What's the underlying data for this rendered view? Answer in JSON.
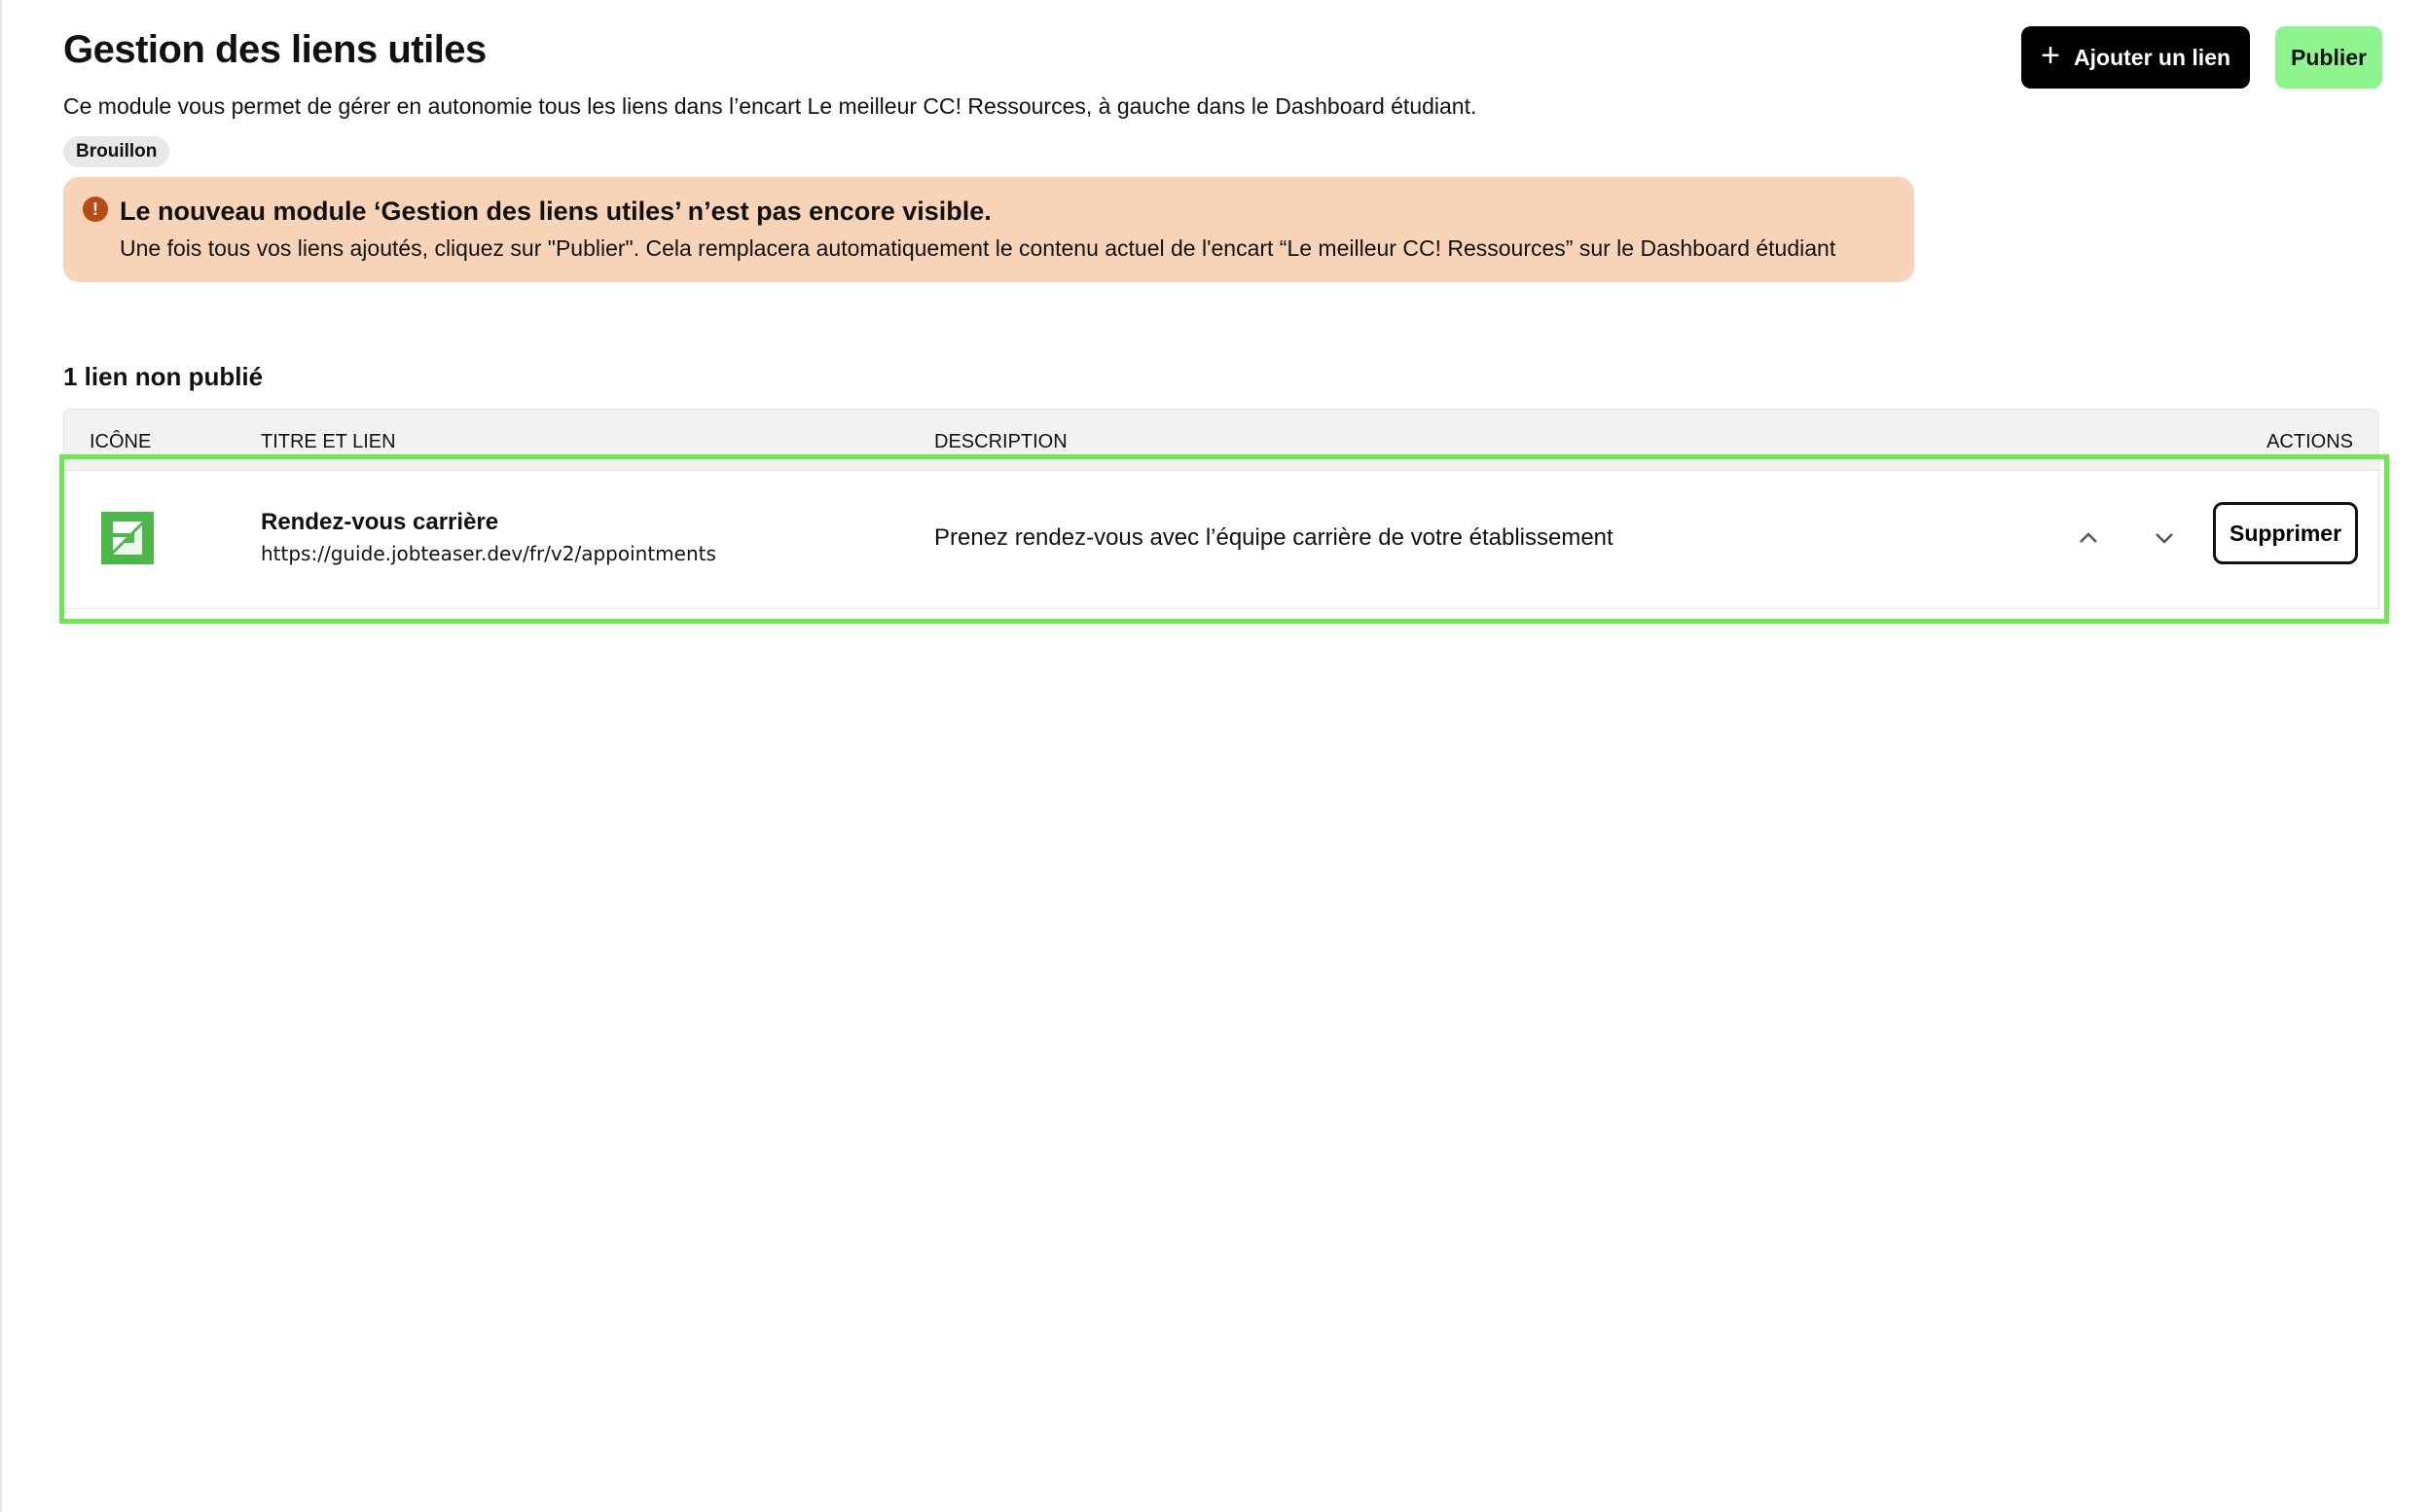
{
  "header": {
    "title": "Gestion des liens utiles",
    "description": "Ce module vous permet de gérer en autonomie tous les liens dans l’encart Le meilleur CC! Ressources, à gauche dans le Dashboard étudiant.",
    "status_badge": "Brouillon",
    "add_button": "Ajouter un lien",
    "add_icon": "plus-icon",
    "publish_button": "Publier"
  },
  "alert": {
    "icon": "exclamation-icon",
    "title": "Le nouveau module ‘Gestion des liens utiles’ n’est pas encore visible.",
    "text": "Une fois tous vos liens ajoutés, cliquez sur \"Publier\". Cela remplacera automatiquement le contenu actuel de l'encart “Le meilleur CC! Ressources” sur le Dashboard étudiant",
    "background": "#f7d4b8",
    "icon_color": "#b84a14"
  },
  "section": {
    "title": "1 lien non publié"
  },
  "table": {
    "columns": {
      "icon": "ICÔNE",
      "title": "TITRE ET LIEN",
      "description": "DESCRIPTION",
      "actions": "ACTIONS"
    },
    "rows": [
      {
        "icon": "jobteaser-logo-icon",
        "title": "Rendez-vous carrière",
        "url": "https://guide.jobteaser.dev/fr/v2/appointments",
        "description": "Prenez rendez-vous avec l’équipe carrière de votre établissement",
        "move_up_icon": "chevron-up-icon",
        "move_down_icon": "chevron-down-icon",
        "delete_label": "Supprimer"
      }
    ]
  },
  "colors": {
    "primary_button": "#000000",
    "publish_button": "#8ef58e",
    "highlight": "#6ee84f",
    "logo": "#4cb84a"
  }
}
